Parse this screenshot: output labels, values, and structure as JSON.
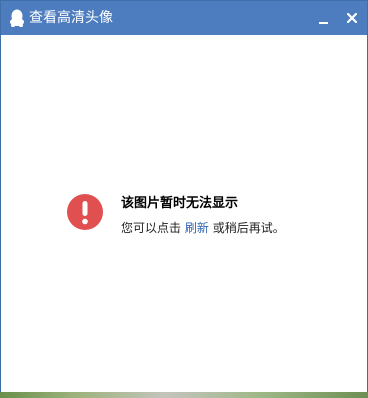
{
  "window": {
    "title": "查看高清头像",
    "titlebar_color": "#4d7dbf",
    "app_icon": "qq-penguin-icon",
    "minimize_icon": "minimize-icon",
    "close_icon": "close-icon"
  },
  "error": {
    "icon": "exclamation-circle-icon",
    "icon_color": "#e05050",
    "title": "该图片暂时无法显示",
    "message_prefix": "您可以点击",
    "refresh_link": "刷新",
    "message_suffix": "或稍后再试。",
    "link_color": "#2d64b3"
  }
}
